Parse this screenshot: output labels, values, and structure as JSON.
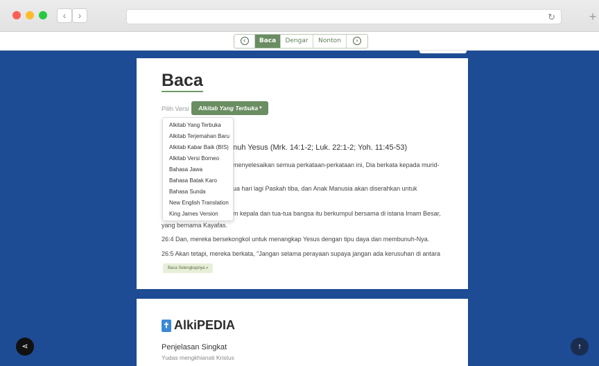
{
  "tabs": {
    "prev_icon": "chevron-left-circle-icon",
    "read": "Baca",
    "listen": "Dengar",
    "watch": "Nonton",
    "next_icon": "chevron-right-circle-icon"
  },
  "main": {
    "heading": "Baca",
    "pick_label": "Pilih Versi",
    "selected_version": "Alkitab Yang Terbuka",
    "passage_title": "nuh Yesus (Mrk. 14:1-2; Luk. 22:1-2; Yoh. 11:45-53)",
    "verses": [
      "menyelesaikan semua perkataan-perkataan ini, Dia berkata kepada murid-",
      "ua hari lagi Paskah tiba, dan Anak Manusia akan diserahkan untuk",
      "m kepala dan tua-tua bangsa itu berkumpul bersama di istana Imam Besar,",
      "yang bernama Kayafas.",
      "26:4 Dan, mereka bersekongkol untuk menangkap Yesus dengan tipu daya dan membunuh-Nya.",
      "26:5 Akan tetapi, mereka berkata, \"Jangan selama perayaan supaya jangan ada kerusuhan di antara"
    ],
    "read_more": "Baca Selengkapnya »"
  },
  "dropdown": {
    "options": [
      "Alkitab Yang Terbuka",
      "Alkitab Terjemahan Baru",
      "Alkitab Kabar Baik (BIS)",
      "Alkitab Versi Borneo",
      "Bahasa Jawa",
      "Bahasa Batak Karo",
      "Bahasa Sunda",
      "New English Translation",
      "King James Version"
    ]
  },
  "alkipedia": {
    "title": "AlkiPEDIA",
    "subtitle": "Penjelasan Singkat",
    "topic": "Yudas mengkhianati Kristus"
  },
  "colors": {
    "page_bg": "#1d4c95",
    "accent_green": "#6a8d62"
  }
}
